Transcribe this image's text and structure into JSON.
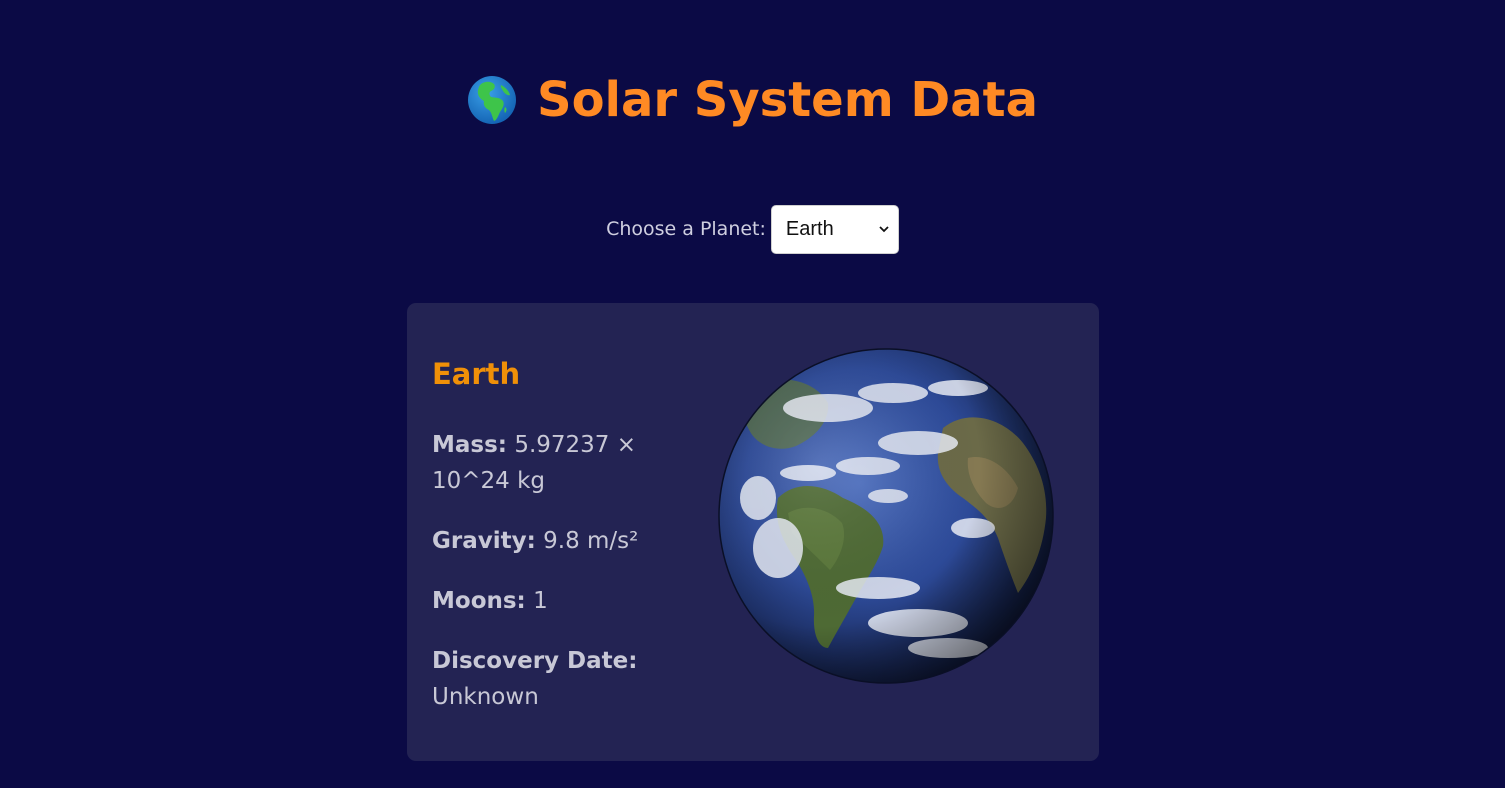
{
  "header": {
    "title": "Solar System Data",
    "icon": "globe-europe-africa-icon"
  },
  "chooser": {
    "label": "Choose a Planet:",
    "selected": "Earth"
  },
  "planet": {
    "name": "Earth",
    "image_icon": "earth-image",
    "facts": [
      {
        "label": "Mass:",
        "value": "5.97237 × 10^24 kg"
      },
      {
        "label": "Gravity:",
        "value": "9.8 m/s²"
      },
      {
        "label": "Moons:",
        "value": "1"
      },
      {
        "label": "Discovery Date:",
        "value": "Unknown"
      }
    ]
  },
  "colors": {
    "background": "#0b0a45",
    "title": "#ff8a24",
    "card": "#232353",
    "planet_name": "#f09008",
    "text": "#c8c8d6"
  }
}
